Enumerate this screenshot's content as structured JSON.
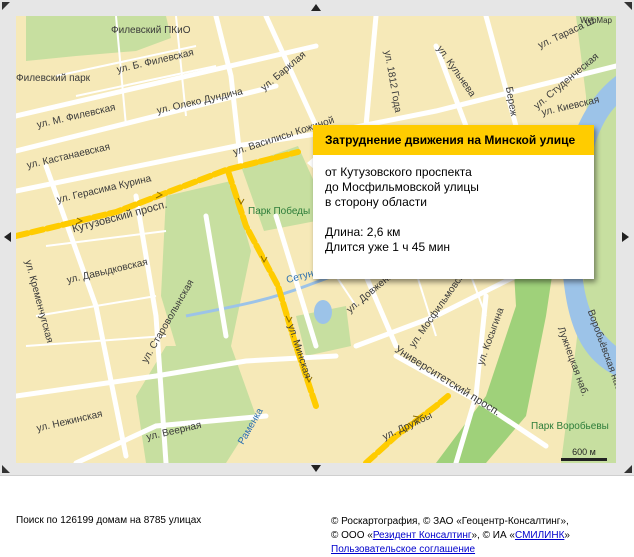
{
  "map": {
    "provider_mark": "WebMap",
    "scale_label": "600 м",
    "labels": {
      "filevsky_pkio": "Филевский ПКиО",
      "filevsky_park": "Филевский парк",
      "b_filevskaya": "ул. Б. Филевская",
      "barklaya": "ул. Барклая",
      "m_filevskaya": "ул. М. Филевская",
      "oleko_dundicha": "ул. Олеко Дундича",
      "kastanaevskaya": "ул. Кастанаевская",
      "gerasima_kurina": "ул. Герасима Курина",
      "kutuzovsky": "Кутузовский просп.",
      "kremenchugskaya": "ул. Кременчугская",
      "davydkovskaya": "ул. Давыдковская",
      "starovolynskaya": "ул. Староволынская",
      "nezhinskaya": "ул. Нежинская",
      "veernaya": "ул. Веерная",
      "ramenka": "Раменка",
      "minskaya": "ул. Минская",
      "setun": "Сетунь",
      "dovzhenko": "ул. Довженко",
      "mosfilmovskaya": "ул. Мосфильмовская",
      "kosygina": "ул. Косыгина",
      "universitetsky": "Университетский просп.",
      "druzhby": "ул. Дружбы",
      "vasilisy": "ул. Василисы Кожиной",
      "park_pobedy": "Парк Победы",
      "goda_1812": "ул. 1812 Года",
      "kulneva": "ул. Кульнева",
      "studencheskaya": "ул. Студенческая",
      "kievskaya": "ул. Киевская",
      "tarasa": "ул. Тараса Ш",
      "berezhkovskaya": "Береж",
      "luzhnetskaya": "Лужнецкая наб.",
      "vorobyovskaya": "Воробьёвская наб.",
      "park_vorobyovy": "Парк Воробьевы"
    }
  },
  "popup": {
    "title": "Затруднение движения на Минской улице",
    "line1": "от Кутузовского проспекта",
    "line2": "до Мосфильмовской улицы",
    "line3": "в сторону области",
    "length": "Длина: 2,6 км",
    "duration": "Длится уже 1 ч 45 мин"
  },
  "footer": {
    "stats": "Поиск по 126199 домам на 8785 улицах",
    "copyright_line1": "© Роскартография, © ЗАО «Геоцентр-Консалтинг»,",
    "copyright_line2_a": "© ООО «",
    "copyright_line2_link1": "Резидент Консалтинг",
    "copyright_line2_b": "», © ИА «",
    "copyright_line2_link2": "СМИЛИНК",
    "copyright_line2_c": "»",
    "agreement_link": "Пользовательское соглашение"
  },
  "colors": {
    "map_base": "#f6e9b8",
    "park": "#c7dfa0",
    "road": "#ffffff",
    "water": "#9cc3e8",
    "jam": "#ffcc00",
    "popup_header": "#ffcc00",
    "link": "#0000cc"
  }
}
